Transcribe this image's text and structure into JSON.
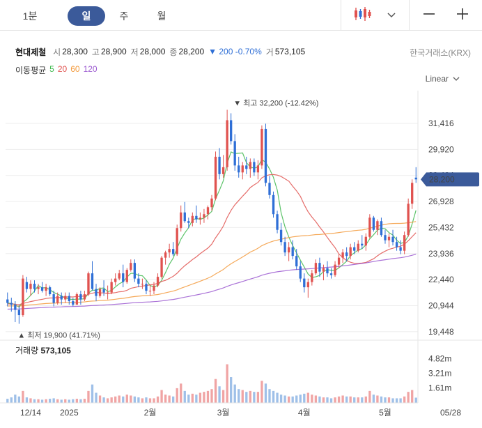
{
  "toolbar": {
    "timeframes": [
      "1분",
      "일",
      "주",
      "월"
    ],
    "active_timeframe": "일",
    "chart_style_icon": "candlestick-icon",
    "zoom_out_icon": "minus-icon",
    "zoom_in_icon": "plus-icon"
  },
  "stock": {
    "name": "현대제철",
    "open_label": "시",
    "open": "28,300",
    "high_label": "고",
    "high": "28,900",
    "low_label": "저",
    "low": "28,000",
    "close_label": "종",
    "close": "28,200",
    "change": "▼ 200 -0.70%",
    "volume_label": "거",
    "volume": "573,105",
    "exchange": "한국거래소(KRX)"
  },
  "moving_averages": {
    "label": "이동평균",
    "periods": [
      {
        "period": "5",
        "color": "#3fb94f"
      },
      {
        "period": "20",
        "color": "#e0524f"
      },
      {
        "period": "60",
        "color": "#f39a3c"
      },
      {
        "period": "120",
        "color": "#9b59d0"
      }
    ]
  },
  "scale_mode": "Linear",
  "colors": {
    "up": "#e0524f",
    "down": "#2f6fd6",
    "volume_up": "#f0a4a4",
    "volume_down": "#9fc0e8",
    "price_badge": "#3b5a9a",
    "marker": "#3b5a9a"
  },
  "chart_data": {
    "type": "candlestick",
    "title": "현대제철",
    "y_ticks": [
      "31,416",
      "29,920",
      "28,424",
      "26,928",
      "25,432",
      "23,936",
      "22,440",
      "20,944",
      "19,448"
    ],
    "y_tick_values": [
      31416,
      29920,
      28424,
      26928,
      25432,
      23936,
      22440,
      20944,
      19448
    ],
    "ylim": [
      19200,
      32900
    ],
    "x_ticks": [
      {
        "label": "12/14",
        "index": 6
      },
      {
        "label": "2025",
        "index": 16
      },
      {
        "label": "2월",
        "index": 37
      },
      {
        "label": "3월",
        "index": 56
      },
      {
        "label": "4월",
        "index": 77
      },
      {
        "label": "5월",
        "index": 98
      },
      {
        "label": "05/28",
        "index": 115
      }
    ],
    "current_price_label": "28,200",
    "current_price": 28200,
    "high_marker": {
      "label": "▼ 최고 32,200 (-12.42%)",
      "value": 32200,
      "index": 59
    },
    "low_marker": {
      "label": "▲ 최저 19,900 (41.71%)",
      "value": 19900,
      "index": 3
    },
    "candles": [
      [
        21300,
        21700,
        20900,
        21100
      ],
      [
        21100,
        21400,
        20600,
        21000
      ],
      [
        21000,
        21200,
        20000,
        20700
      ],
      [
        20700,
        21000,
        19900,
        20400
      ],
      [
        20400,
        22700,
        20300,
        22500
      ],
      [
        22300,
        22600,
        21700,
        21900
      ],
      [
        21900,
        22400,
        21500,
        22200
      ],
      [
        22200,
        22400,
        21700,
        21900
      ],
      [
        21900,
        22200,
        21600,
        22000
      ],
      [
        22000,
        22300,
        21700,
        21800
      ],
      [
        21800,
        22200,
        21500,
        22000
      ],
      [
        22000,
        22100,
        21500,
        21600
      ],
      [
        21600,
        21800,
        20900,
        21100
      ],
      [
        21100,
        21700,
        21000,
        21500
      ],
      [
        21500,
        21700,
        21000,
        21300
      ],
      [
        21300,
        21700,
        21100,
        21500
      ],
      [
        21500,
        21700,
        21000,
        21200
      ],
      [
        21200,
        21400,
        20900,
        21000
      ],
      [
        21000,
        21700,
        21000,
        21600
      ],
      [
        21600,
        21800,
        21000,
        21300
      ],
      [
        21300,
        21800,
        21200,
        21600
      ],
      [
        21600,
        22900,
        21500,
        22800
      ],
      [
        22800,
        23500,
        21800,
        21900
      ],
      [
        21900,
        22200,
        21200,
        21500
      ],
      [
        21500,
        22000,
        21400,
        21900
      ],
      [
        21900,
        22400,
        21500,
        21700
      ],
      [
        21700,
        22100,
        21300,
        21700
      ],
      [
        21700,
        22500,
        21600,
        22300
      ],
      [
        22300,
        22800,
        22100,
        22500
      ],
      [
        22500,
        23000,
        22400,
        22800
      ],
      [
        22800,
        23300,
        22000,
        22300
      ],
      [
        22300,
        23100,
        22200,
        23000
      ],
      [
        23000,
        23600,
        22900,
        23400
      ],
      [
        23400,
        23600,
        22300,
        22500
      ],
      [
        22500,
        22800,
        22000,
        22200
      ],
      [
        22200,
        22500,
        21900,
        22200
      ],
      [
        22200,
        22400,
        21600,
        21800
      ],
      [
        21800,
        22100,
        21500,
        21800
      ],
      [
        21800,
        22300,
        21600,
        22100
      ],
      [
        22100,
        22800,
        22000,
        22600
      ],
      [
        22600,
        23800,
        22500,
        23700
      ],
      [
        23700,
        24100,
        23300,
        24000
      ],
      [
        24000,
        24500,
        23700,
        24200
      ],
      [
        24200,
        24600,
        23800,
        23900
      ],
      [
        23900,
        25600,
        23800,
        25400
      ],
      [
        25400,
        26700,
        25200,
        26300
      ],
      [
        26300,
        26900,
        25700,
        25800
      ],
      [
        25800,
        26000,
        25400,
        25700
      ],
      [
        25700,
        26300,
        25500,
        26100
      ],
      [
        26100,
        26700,
        25700,
        25900
      ],
      [
        25900,
        26300,
        25600,
        26000
      ],
      [
        26000,
        26500,
        25700,
        26200
      ],
      [
        26200,
        26700,
        25900,
        26600
      ],
      [
        26600,
        27300,
        26400,
        27100
      ],
      [
        27100,
        29800,
        27000,
        29500
      ],
      [
        29500,
        30000,
        28200,
        28500
      ],
      [
        28500,
        29600,
        28300,
        28900
      ],
      [
        28900,
        32200,
        28700,
        31600
      ],
      [
        31600,
        32000,
        30200,
        30400
      ],
      [
        30400,
        30800,
        28700,
        29000
      ],
      [
        29000,
        29500,
        28300,
        28600
      ],
      [
        28600,
        29200,
        28200,
        29000
      ],
      [
        29000,
        29500,
        28500,
        28800
      ],
      [
        28800,
        29400,
        28300,
        29200
      ],
      [
        29200,
        29400,
        28400,
        28600
      ],
      [
        28600,
        29300,
        28200,
        29000
      ],
      [
        29000,
        31300,
        28800,
        31100
      ],
      [
        31100,
        31400,
        27800,
        28000
      ],
      [
        28000,
        28400,
        27100,
        27300
      ],
      [
        27300,
        27500,
        26000,
        26200
      ],
      [
        26200,
        26400,
        25100,
        25300
      ],
      [
        25300,
        25700,
        24400,
        24600
      ],
      [
        24600,
        24900,
        23800,
        24000
      ],
      [
        24000,
        24600,
        23500,
        24300
      ],
      [
        24300,
        24700,
        23600,
        23800
      ],
      [
        23800,
        24200,
        23000,
        23200
      ],
      [
        23200,
        23500,
        22300,
        22500
      ],
      [
        22500,
        22800,
        21700,
        22000
      ],
      [
        22000,
        22500,
        21400,
        22300
      ],
      [
        22300,
        23000,
        22100,
        22800
      ],
      [
        22800,
        23600,
        22700,
        23400
      ],
      [
        23400,
        23700,
        22600,
        22900
      ],
      [
        22900,
        23300,
        22400,
        23100
      ],
      [
        23100,
        23500,
        22600,
        22800
      ],
      [
        22800,
        23100,
        22500,
        22700
      ],
      [
        22700,
        23500,
        22600,
        23300
      ],
      [
        23300,
        23900,
        23100,
        23700
      ],
      [
        23700,
        24200,
        23400,
        24000
      ],
      [
        24000,
        24300,
        23500,
        23800
      ],
      [
        23800,
        24500,
        23600,
        24300
      ],
      [
        24300,
        24600,
        23900,
        24100
      ],
      [
        24100,
        24700,
        24000,
        24500
      ],
      [
        24500,
        25000,
        24200,
        24400
      ],
      [
        24400,
        25100,
        24100,
        24900
      ],
      [
        24900,
        26200,
        24800,
        26000
      ],
      [
        26000,
        26100,
        25200,
        25300
      ],
      [
        25300,
        25900,
        25000,
        25800
      ],
      [
        25800,
        26000,
        24900,
        25000
      ],
      [
        25000,
        25300,
        24500,
        24700
      ],
      [
        24700,
        25100,
        24300,
        24900
      ],
      [
        24900,
        25300,
        24400,
        24600
      ],
      [
        24600,
        24900,
        24100,
        24300
      ],
      [
        24300,
        24700,
        23900,
        24100
      ],
      [
        24100,
        25200,
        23900,
        25000
      ],
      [
        25000,
        27100,
        24900,
        26800
      ],
      [
        26800,
        28200,
        26500,
        28000
      ],
      [
        28300,
        28900,
        28000,
        28200
      ]
    ],
    "volume_ticks": [
      "4.82m",
      "3.21m",
      "1.61m"
    ],
    "volume_tick_values": [
      4820000,
      3210000,
      1610000
    ],
    "volume_title": "거래량",
    "volume_value": "573,105",
    "volumes": [
      0.45,
      0.6,
      0.9,
      0.7,
      1.3,
      0.6,
      0.5,
      0.4,
      0.4,
      0.35,
      0.4,
      0.45,
      0.5,
      0.4,
      0.35,
      0.4,
      0.35,
      0.4,
      0.45,
      0.4,
      0.45,
      1.3,
      2.0,
      1.1,
      0.8,
      0.6,
      0.5,
      0.6,
      0.7,
      0.8,
      0.7,
      0.9,
      0.8,
      0.7,
      0.6,
      0.5,
      0.6,
      0.5,
      0.5,
      0.7,
      1.4,
      0.9,
      0.8,
      0.7,
      1.6,
      2.1,
      1.3,
      0.9,
      1.0,
      0.9,
      1.1,
      1.2,
      1.3,
      1.5,
      2.6,
      1.8,
      1.4,
      4.2,
      2.8,
      2.0,
      1.5,
      1.4,
      1.2,
      1.3,
      1.2,
      1.2,
      2.4,
      2.1,
      1.5,
      1.3,
      1.1,
      0.9,
      0.8,
      0.7,
      0.7,
      0.8,
      0.9,
      1.0,
      1.1,
      0.9,
      0.8,
      0.7,
      0.6,
      0.6,
      0.5,
      0.6,
      0.7,
      0.8,
      0.7,
      0.7,
      0.6,
      0.6,
      0.6,
      0.7,
      1.3,
      0.9,
      0.8,
      0.7,
      0.6,
      0.6,
      0.5,
      0.5,
      0.5,
      0.7,
      1.2,
      1.4,
      0.57
    ]
  }
}
